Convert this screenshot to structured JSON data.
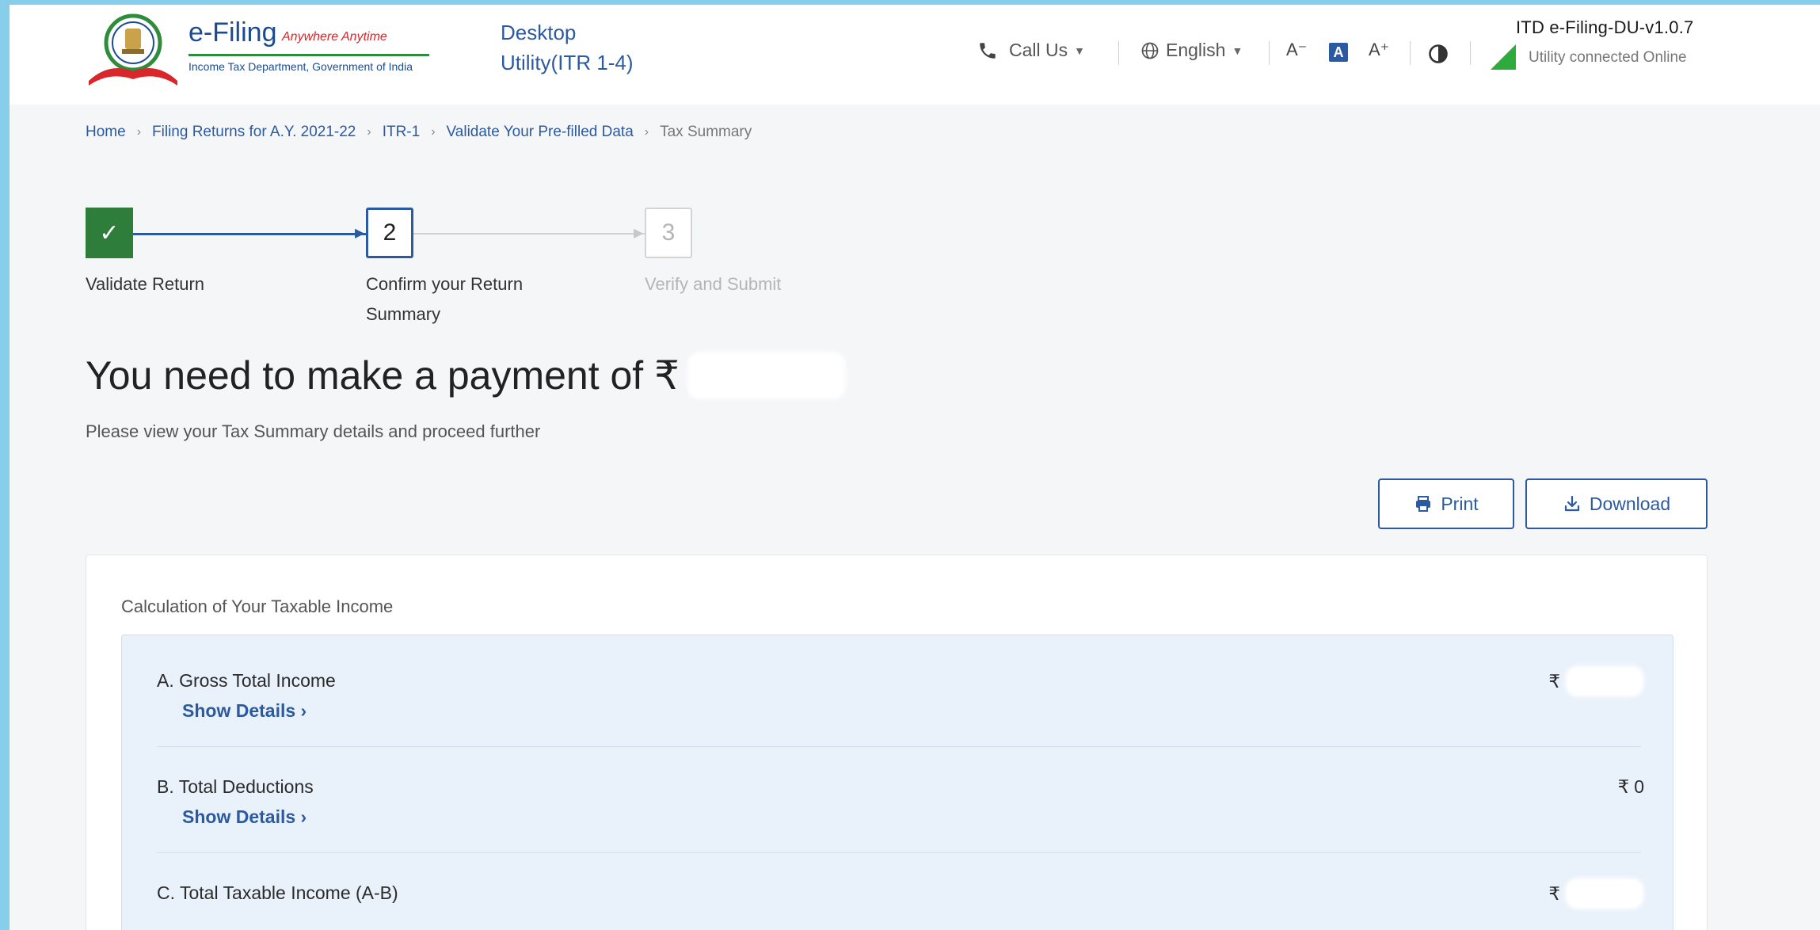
{
  "header": {
    "brand_name": "e-Filing",
    "brand_tagline": "Anywhere Anytime",
    "brand_subtitle": "Income Tax Department, Government of India",
    "utility_title_line1": "Desktop",
    "utility_title_line2": "Utility(ITR 1-4)",
    "call_us_label": "Call Us",
    "language_label": "English",
    "font_decrease_label": "A⁻",
    "font_default_label": "A",
    "font_increase_label": "A⁺",
    "version": "ITD e-Filing-DU-v1.0.7",
    "connection_status": "Utility connected Online"
  },
  "breadcrumb": {
    "items": [
      "Home",
      "Filing Returns for A.Y. 2021-22",
      "ITR-1",
      "Validate Your Pre-filled Data"
    ],
    "current": "Tax Summary",
    "separator": "›"
  },
  "stepper": {
    "steps": [
      {
        "number": "✓",
        "label": "Validate Return",
        "state": "done"
      },
      {
        "number": "2",
        "label": "Confirm your Return Summary",
        "state": "current"
      },
      {
        "number": "3",
        "label": "Verify and Submit",
        "state": "future"
      }
    ]
  },
  "main": {
    "heading": "You need to make a payment of ₹",
    "subtext": "Please view your Tax Summary details and proceed further",
    "print_label": "Print",
    "download_label": "Download"
  },
  "summary": {
    "title": "Calculation of Your Taxable Income",
    "rows": [
      {
        "label": "A. Gross Total Income",
        "link": "Show Details ›",
        "currency": "₹",
        "value": ""
      },
      {
        "label": "B. Total Deductions",
        "link": "Show Details ›",
        "currency": "₹",
        "value": "0"
      },
      {
        "label": "C. Total Taxable Income (A-B)",
        "link": "",
        "currency": "₹",
        "value": ""
      }
    ]
  },
  "colors": {
    "accent": "#2c5aa0",
    "success": "#2f7d3a",
    "page_bg": "#f5f6f8",
    "panel_bg": "#e9f1fb",
    "frame": "#87CEEB"
  }
}
